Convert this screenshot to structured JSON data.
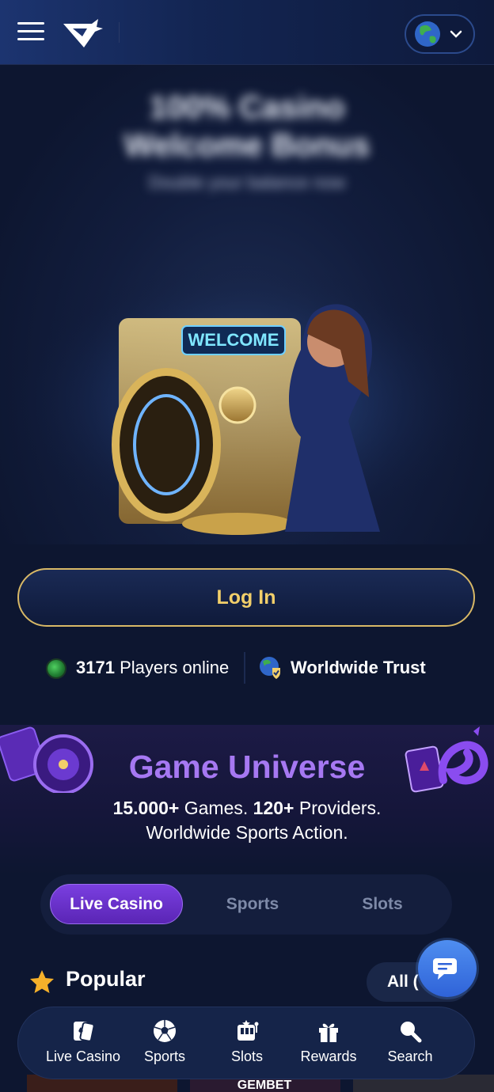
{
  "header": {
    "menu_icon": "hamburger-icon",
    "logo_icon": "gembet-logo-icon",
    "language_icon": "globe-icon"
  },
  "hero": {
    "title_line1": "100% Casino",
    "title_line2": "Welcome Bonus",
    "subtitle": "Double your balance now",
    "badge_text": "WELCOME"
  },
  "login": {
    "label": "Log In"
  },
  "stats": {
    "players_count": "3171",
    "players_label": "Players online",
    "trust_label": "Worldwide Trust"
  },
  "universe": {
    "title": "Game Universe",
    "games_count": "15.000+",
    "games_label": "Games.",
    "providers_count": "120+",
    "providers_label": "Providers.",
    "line2": "Worldwide Sports Action."
  },
  "tabs": [
    {
      "label": "Live Casino",
      "active": true
    },
    {
      "label": "Sports",
      "active": false
    },
    {
      "label": "Slots",
      "active": false
    }
  ],
  "popular": {
    "title": "Popular",
    "all_label": "All (",
    "star_icon": "star-icon"
  },
  "bottom_nav": [
    {
      "label": "Live Casino",
      "icon": "cards-icon"
    },
    {
      "label": "Sports",
      "icon": "soccer-ball-icon"
    },
    {
      "label": "Slots",
      "icon": "slot-machine-icon"
    },
    {
      "label": "Rewards",
      "icon": "gift-icon"
    },
    {
      "label": "Search",
      "icon": "search-icon"
    }
  ],
  "colors": {
    "background": "#0d1630",
    "accent_gold": "#f2cf6a",
    "accent_purple": "#a678f2",
    "chat_blue": "#3a74e0"
  },
  "thumbnail_text": "GEMBET"
}
